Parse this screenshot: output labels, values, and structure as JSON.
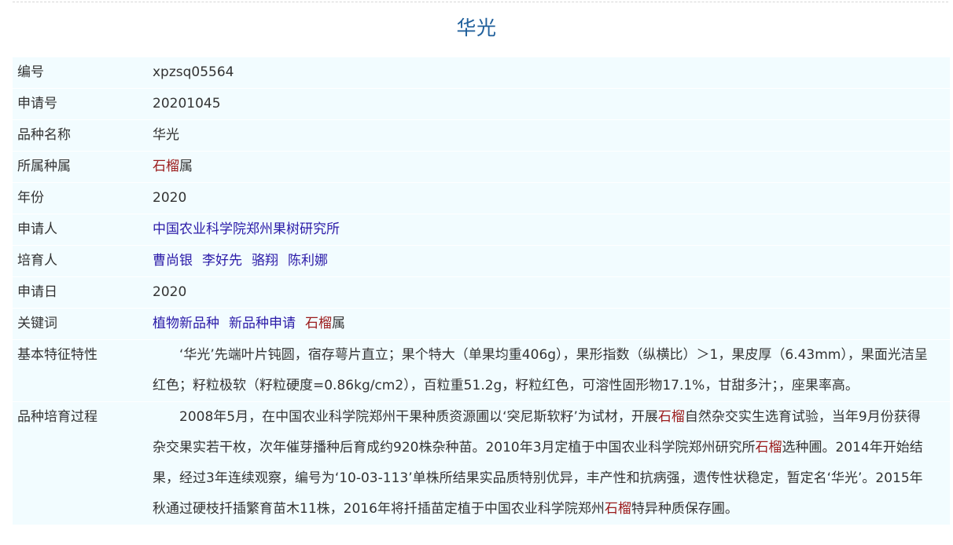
{
  "title": "华光",
  "rows": [
    {
      "label": "编号",
      "value": "xpzsq05564"
    },
    {
      "label": "申请号",
      "value": "20201045"
    },
    {
      "label": "品种名称",
      "value": "华光"
    },
    {
      "label": "所属种属",
      "highlight": "石榴",
      "suffix": "属"
    },
    {
      "label": "年份",
      "value": "2020"
    },
    {
      "label": "申请人",
      "link": "中国农业科学院郑州果树研究所"
    },
    {
      "label": "培育人",
      "links": [
        "曹尚银",
        "李好先",
        "骆翔",
        "陈利娜"
      ]
    },
    {
      "label": "申请日",
      "value": "2020"
    },
    {
      "label": "关键词",
      "links": [
        "植物新品种",
        "新品种申请"
      ],
      "highlight": "石榴",
      "suffix": "属"
    },
    {
      "label": "基本特征特性",
      "paragraph": "‘华光’先端叶片钝圆，宿存萼片直立；果个特大（单果均重406g），果形指数（纵横比）＞1，果皮厚（6.43mm），果面光洁呈红色；籽粒极软（籽粒硬度=0.86kg/cm2），百粒重51.2g，籽粒红色，可溶性固形物17.1%，甘甜多汁；，座果率高。"
    },
    {
      "label": "品种培育过程",
      "segments": [
        {
          "text": "2008年5月，在中国农业科学院郑州干果种质资源圃以‘突尼斯软籽’为试材，开展",
          "highlight": false
        },
        {
          "text": "石榴",
          "highlight": true
        },
        {
          "text": "自然杂交实生选育试验，当年9月份获得杂交果实若干枚，次年催芽播种后育成约920株杂种苗。2010年3月定植于中国农业科学院郑州研究所",
          "highlight": false
        },
        {
          "text": "石榴",
          "highlight": true
        },
        {
          "text": "选种圃。2014年开始结果，经过3年连续观察，编号为‘10-03-113’单株所结果实品质特别优异，丰产性和抗病强，遗传性状稳定，暂定名‘华光’。2015年秋通过硬枝扦插繁育苗木11株，2016年将扦插苗定植于中国农业科学院郑州",
          "highlight": false
        },
        {
          "text": "石榴",
          "highlight": true
        },
        {
          "text": "特异种质保存圃。",
          "highlight": false
        }
      ]
    }
  ]
}
